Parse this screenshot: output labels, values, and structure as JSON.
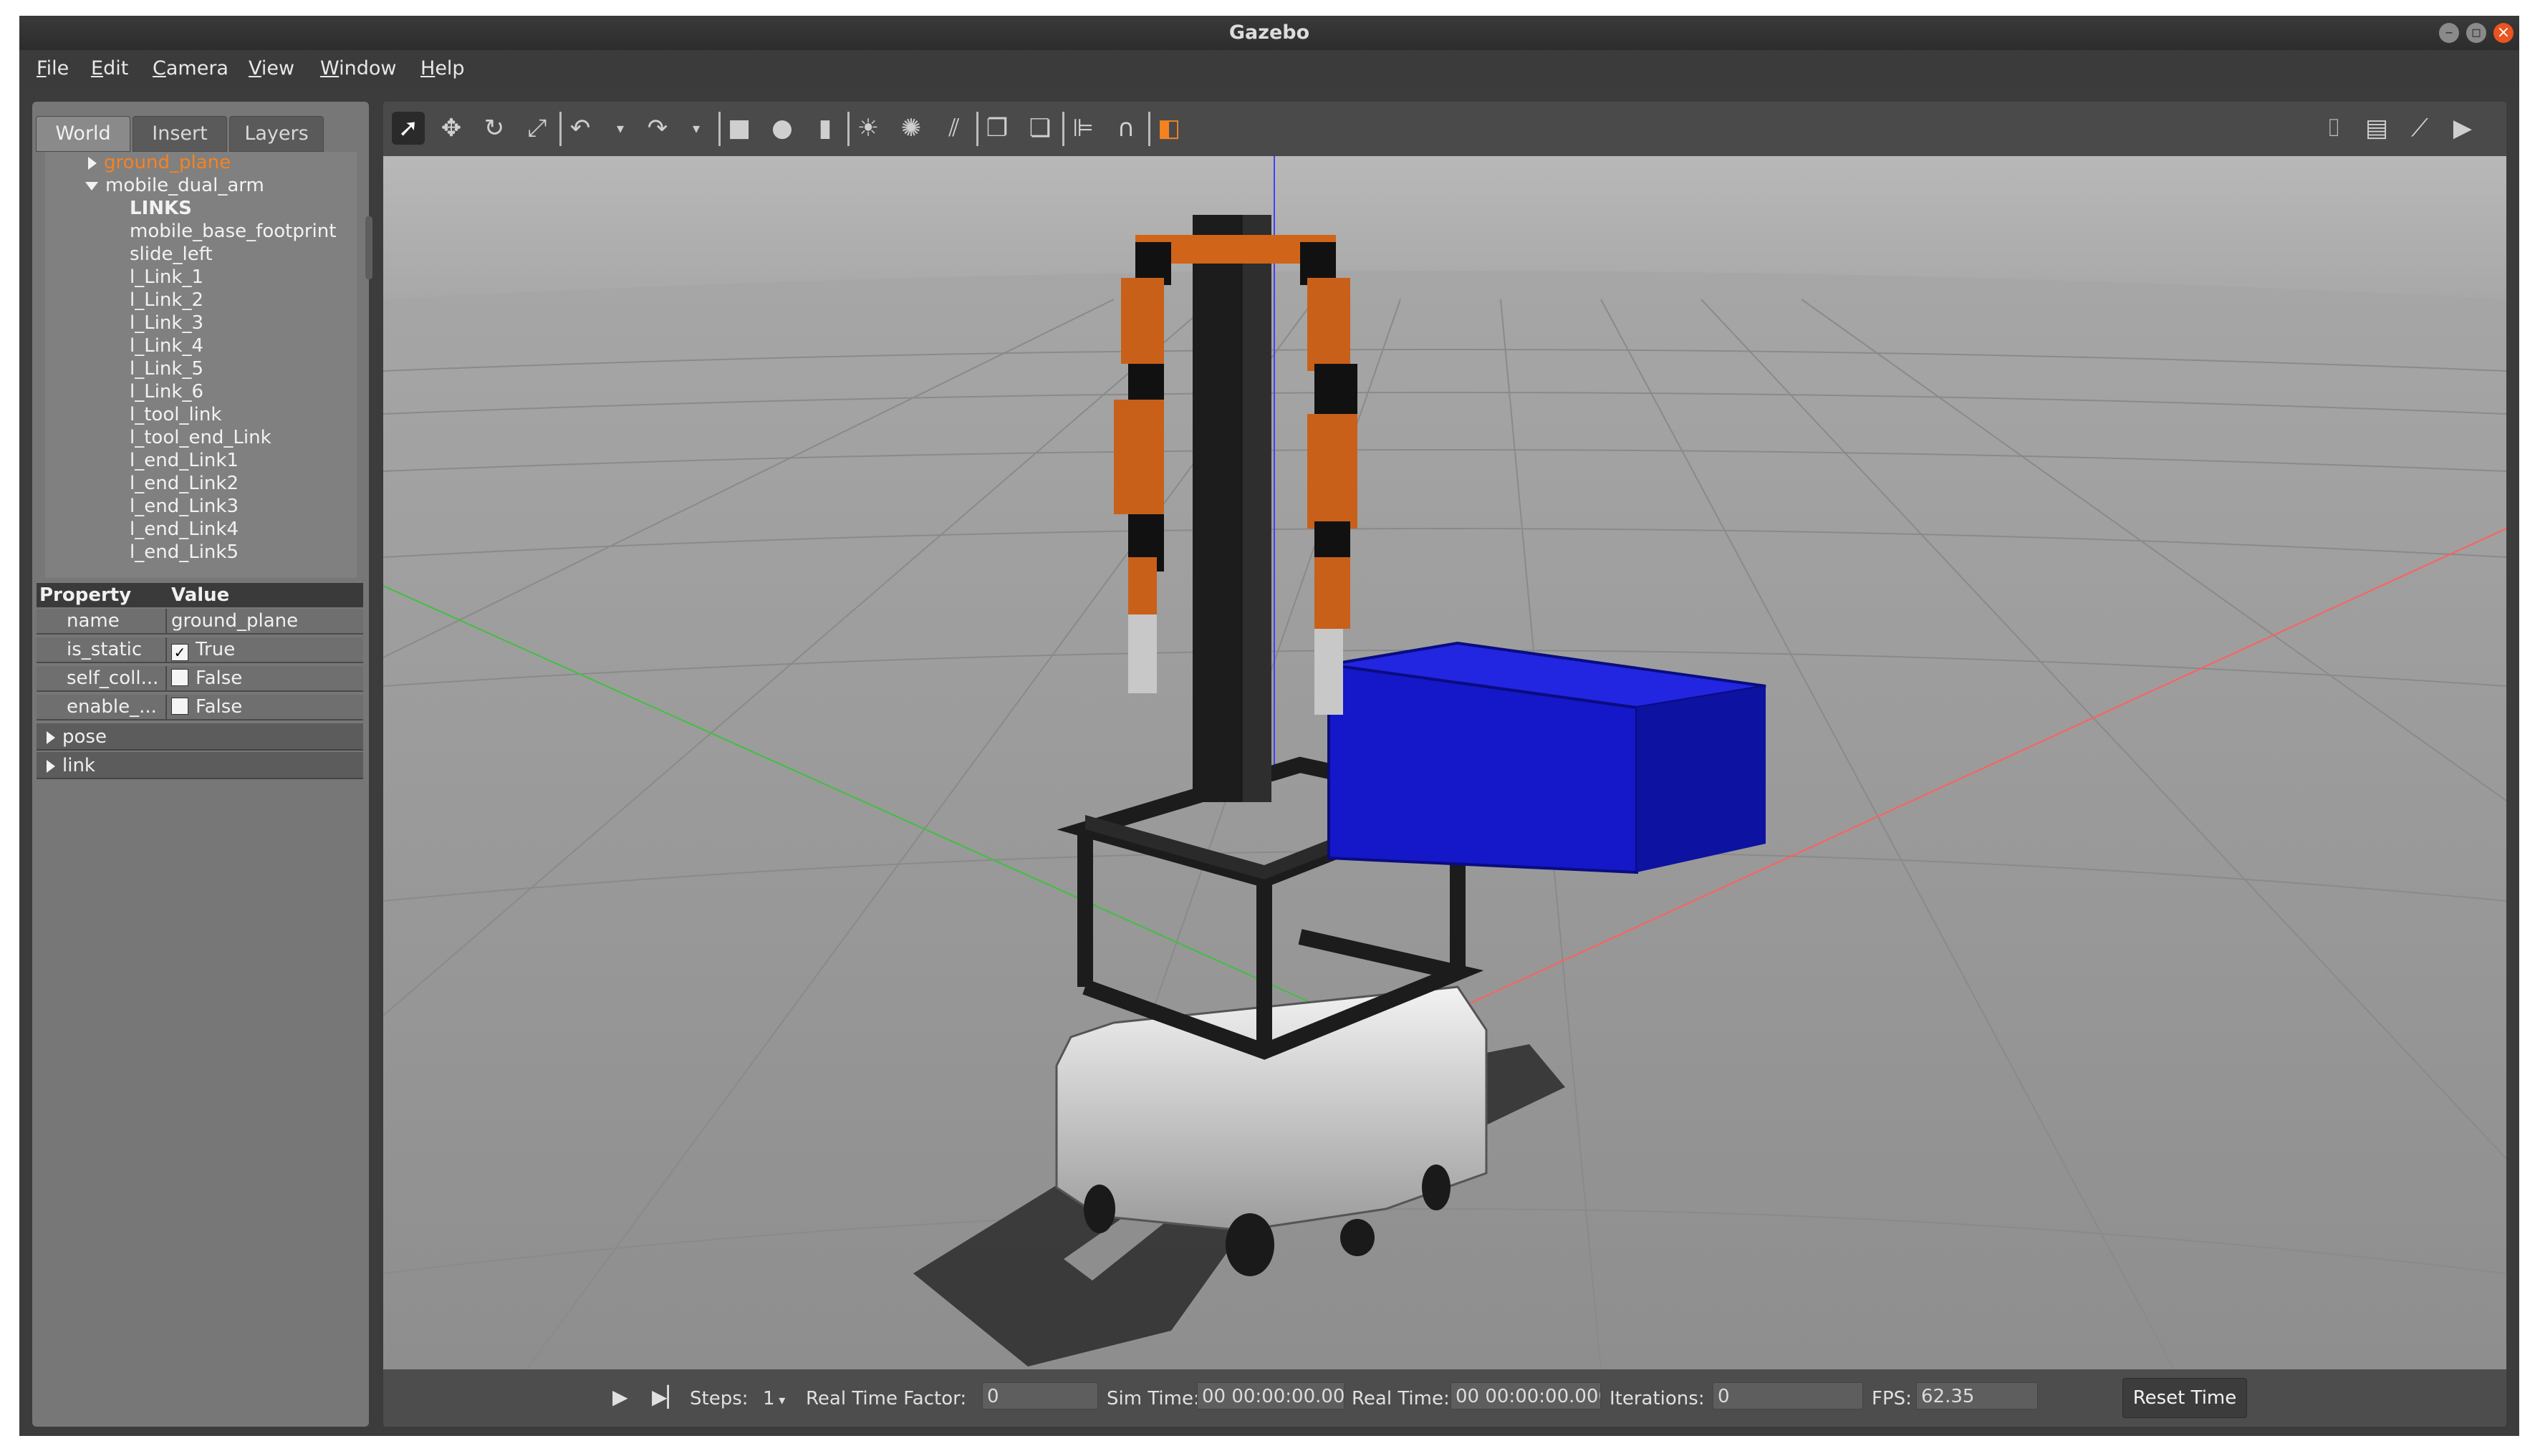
{
  "window": {
    "title": "Gazebo"
  },
  "menu": [
    {
      "underline": "F",
      "rest": "ile"
    },
    {
      "underline": "E",
      "rest": "dit"
    },
    {
      "underline": "C",
      "rest": "amera"
    },
    {
      "underline": "V",
      "rest": "iew"
    },
    {
      "underline": "W",
      "rest": "indow"
    },
    {
      "underline": "H",
      "rest": "elp"
    }
  ],
  "tabs": [
    "World",
    "Insert",
    "Layers"
  ],
  "tree": {
    "ground_plane": "ground_plane",
    "model": "mobile_dual_arm",
    "links_header": "LINKS",
    "links": [
      "mobile_base_footprint",
      "slide_left",
      "l_Link_1",
      "l_Link_2",
      "l_Link_3",
      "l_Link_4",
      "l_Link_5",
      "l_Link_6",
      "l_tool_link",
      "l_tool_end_Link",
      "l_end_Link1",
      "l_end_Link2",
      "l_end_Link3",
      "l_end_Link4",
      "l_end_Link5"
    ]
  },
  "properties": {
    "header_property": "Property",
    "header_value": "Value",
    "rows": [
      {
        "key": "name",
        "value": "ground_plane"
      },
      {
        "key": "is_static",
        "value": "True",
        "checked": true
      },
      {
        "key": "self_coll...",
        "value": "False",
        "checked": false
      },
      {
        "key": "enable_...",
        "value": "False",
        "checked": false
      }
    ],
    "groups": [
      "pose",
      "link"
    ]
  },
  "toolbar": {
    "icons": [
      "select-mode-icon",
      "translate-mode-icon",
      "rotate-mode-icon",
      "scale-mode-icon",
      "undo-icon",
      "undo-dropdown-icon",
      "redo-icon",
      "redo-dropdown-icon",
      "box-icon",
      "sphere-icon",
      "cylinder-icon",
      "point-light-icon",
      "spot-light-icon",
      "directional-light-icon",
      "copy-icon",
      "paste-icon",
      "align-icon",
      "snap-icon",
      "change-view-icon",
      "screenshot-icon",
      "log-icon",
      "plot-icon",
      "record-video-icon"
    ]
  },
  "bottombar": {
    "steps_label": "Steps:",
    "steps_value": "1",
    "rtf_label": "Real Time Factor:",
    "rtf_value": "0",
    "sim_time_label": "Sim Time:",
    "sim_time_value": "00 00:00:00.000",
    "real_time_label": "Real Time:",
    "real_time_value": "00 00:00:00.000",
    "iterations_label": "Iterations:",
    "iterations_value": "0",
    "fps_label": "FPS:",
    "fps_value": "62.35",
    "reset_label": "Reset Time"
  },
  "colors": {
    "accent": "#f58220",
    "robot_orange": "#c8601a",
    "bin_blue": "#1418c8",
    "axis_red": "#ff6060",
    "axis_green": "#40c040",
    "axis_blue": "#4040ff"
  }
}
